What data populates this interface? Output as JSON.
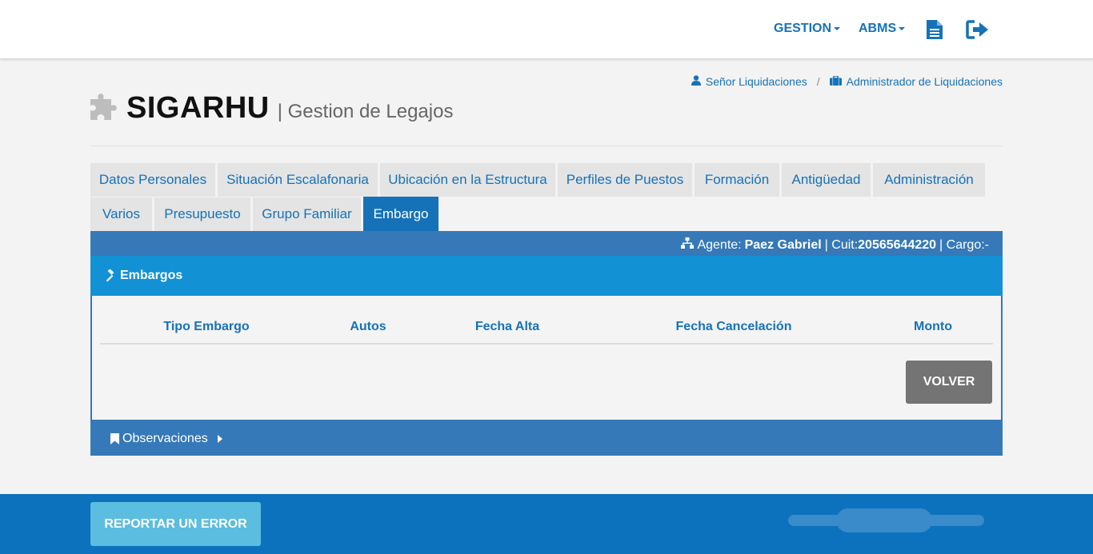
{
  "nav": {
    "gestion": "GESTION",
    "abms": "ABMS"
  },
  "breadcrumb": {
    "user": "Señor Liquidaciones",
    "separator": "/",
    "role": "Administrador de Liquidaciones"
  },
  "brand": {
    "title": "SIGARHU",
    "subtitle": "| Gestion de Legajos"
  },
  "tabs": [
    {
      "label": "Datos Personales"
    },
    {
      "label": "Situación Escalafonaria"
    },
    {
      "label": "Ubicación en la Estructura"
    },
    {
      "label": "Perfiles de Puestos"
    },
    {
      "label": "Formación"
    },
    {
      "label": "Antigüedad"
    },
    {
      "label": "Administración"
    },
    {
      "label": "Varios"
    },
    {
      "label": "Presupuesto"
    },
    {
      "label": "Grupo Familiar"
    },
    {
      "label": "Embargo",
      "active": true
    }
  ],
  "agent": {
    "label": "Agente:",
    "name": "Paez Gabriel",
    "cuit_label": "| Cuit:",
    "cuit": "20565644220",
    "cargo": "| Cargo:-"
  },
  "embargos": {
    "title": "Embargos",
    "columns": [
      "Tipo Embargo",
      "Autos",
      "Fecha Alta",
      "Fecha Cancelación",
      "Monto"
    ],
    "rows": [],
    "volver_label": "VOLVER"
  },
  "observaciones": {
    "label": "Observaciones"
  },
  "footer": {
    "report_label": "REPORTAR UN ERROR"
  },
  "colors": {
    "primary": "#1672b8",
    "panel": "#3579b8",
    "header_bar": "#1292d4",
    "footer": "#0d72bd",
    "report_button": "#5bbde0",
    "volver_button": "#747474"
  }
}
